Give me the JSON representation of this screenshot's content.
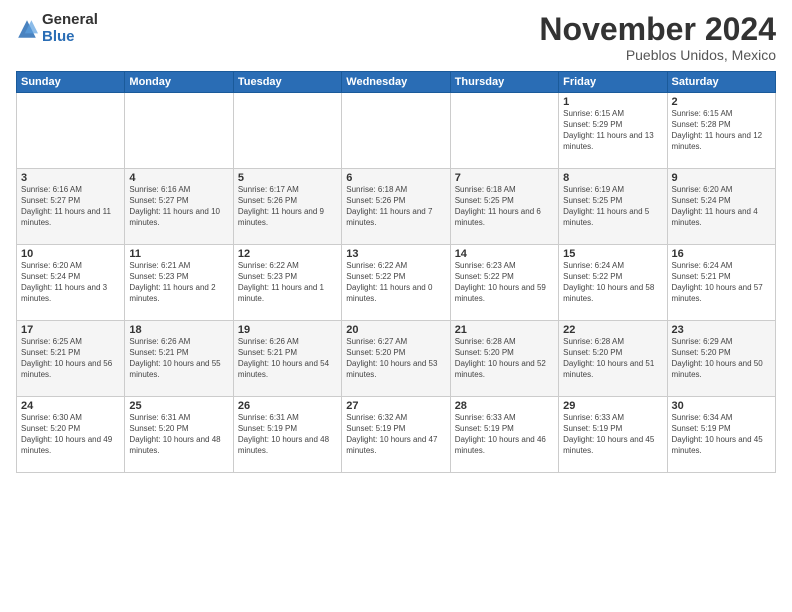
{
  "logo": {
    "general": "General",
    "blue": "Blue"
  },
  "header": {
    "month": "November 2024",
    "location": "Pueblos Unidos, Mexico"
  },
  "weekdays": [
    "Sunday",
    "Monday",
    "Tuesday",
    "Wednesday",
    "Thursday",
    "Friday",
    "Saturday"
  ],
  "weeks": [
    [
      {
        "day": "",
        "info": ""
      },
      {
        "day": "",
        "info": ""
      },
      {
        "day": "",
        "info": ""
      },
      {
        "day": "",
        "info": ""
      },
      {
        "day": "",
        "info": ""
      },
      {
        "day": "1",
        "info": "Sunrise: 6:15 AM\nSunset: 5:29 PM\nDaylight: 11 hours and 13 minutes."
      },
      {
        "day": "2",
        "info": "Sunrise: 6:15 AM\nSunset: 5:28 PM\nDaylight: 11 hours and 12 minutes."
      }
    ],
    [
      {
        "day": "3",
        "info": "Sunrise: 6:16 AM\nSunset: 5:27 PM\nDaylight: 11 hours and 11 minutes."
      },
      {
        "day": "4",
        "info": "Sunrise: 6:16 AM\nSunset: 5:27 PM\nDaylight: 11 hours and 10 minutes."
      },
      {
        "day": "5",
        "info": "Sunrise: 6:17 AM\nSunset: 5:26 PM\nDaylight: 11 hours and 9 minutes."
      },
      {
        "day": "6",
        "info": "Sunrise: 6:18 AM\nSunset: 5:26 PM\nDaylight: 11 hours and 7 minutes."
      },
      {
        "day": "7",
        "info": "Sunrise: 6:18 AM\nSunset: 5:25 PM\nDaylight: 11 hours and 6 minutes."
      },
      {
        "day": "8",
        "info": "Sunrise: 6:19 AM\nSunset: 5:25 PM\nDaylight: 11 hours and 5 minutes."
      },
      {
        "day": "9",
        "info": "Sunrise: 6:20 AM\nSunset: 5:24 PM\nDaylight: 11 hours and 4 minutes."
      }
    ],
    [
      {
        "day": "10",
        "info": "Sunrise: 6:20 AM\nSunset: 5:24 PM\nDaylight: 11 hours and 3 minutes."
      },
      {
        "day": "11",
        "info": "Sunrise: 6:21 AM\nSunset: 5:23 PM\nDaylight: 11 hours and 2 minutes."
      },
      {
        "day": "12",
        "info": "Sunrise: 6:22 AM\nSunset: 5:23 PM\nDaylight: 11 hours and 1 minute."
      },
      {
        "day": "13",
        "info": "Sunrise: 6:22 AM\nSunset: 5:22 PM\nDaylight: 11 hours and 0 minutes."
      },
      {
        "day": "14",
        "info": "Sunrise: 6:23 AM\nSunset: 5:22 PM\nDaylight: 10 hours and 59 minutes."
      },
      {
        "day": "15",
        "info": "Sunrise: 6:24 AM\nSunset: 5:22 PM\nDaylight: 10 hours and 58 minutes."
      },
      {
        "day": "16",
        "info": "Sunrise: 6:24 AM\nSunset: 5:21 PM\nDaylight: 10 hours and 57 minutes."
      }
    ],
    [
      {
        "day": "17",
        "info": "Sunrise: 6:25 AM\nSunset: 5:21 PM\nDaylight: 10 hours and 56 minutes."
      },
      {
        "day": "18",
        "info": "Sunrise: 6:26 AM\nSunset: 5:21 PM\nDaylight: 10 hours and 55 minutes."
      },
      {
        "day": "19",
        "info": "Sunrise: 6:26 AM\nSunset: 5:21 PM\nDaylight: 10 hours and 54 minutes."
      },
      {
        "day": "20",
        "info": "Sunrise: 6:27 AM\nSunset: 5:20 PM\nDaylight: 10 hours and 53 minutes."
      },
      {
        "day": "21",
        "info": "Sunrise: 6:28 AM\nSunset: 5:20 PM\nDaylight: 10 hours and 52 minutes."
      },
      {
        "day": "22",
        "info": "Sunrise: 6:28 AM\nSunset: 5:20 PM\nDaylight: 10 hours and 51 minutes."
      },
      {
        "day": "23",
        "info": "Sunrise: 6:29 AM\nSunset: 5:20 PM\nDaylight: 10 hours and 50 minutes."
      }
    ],
    [
      {
        "day": "24",
        "info": "Sunrise: 6:30 AM\nSunset: 5:20 PM\nDaylight: 10 hours and 49 minutes."
      },
      {
        "day": "25",
        "info": "Sunrise: 6:31 AM\nSunset: 5:20 PM\nDaylight: 10 hours and 48 minutes."
      },
      {
        "day": "26",
        "info": "Sunrise: 6:31 AM\nSunset: 5:19 PM\nDaylight: 10 hours and 48 minutes."
      },
      {
        "day": "27",
        "info": "Sunrise: 6:32 AM\nSunset: 5:19 PM\nDaylight: 10 hours and 47 minutes."
      },
      {
        "day": "28",
        "info": "Sunrise: 6:33 AM\nSunset: 5:19 PM\nDaylight: 10 hours and 46 minutes."
      },
      {
        "day": "29",
        "info": "Sunrise: 6:33 AM\nSunset: 5:19 PM\nDaylight: 10 hours and 45 minutes."
      },
      {
        "day": "30",
        "info": "Sunrise: 6:34 AM\nSunset: 5:19 PM\nDaylight: 10 hours and 45 minutes."
      }
    ]
  ]
}
